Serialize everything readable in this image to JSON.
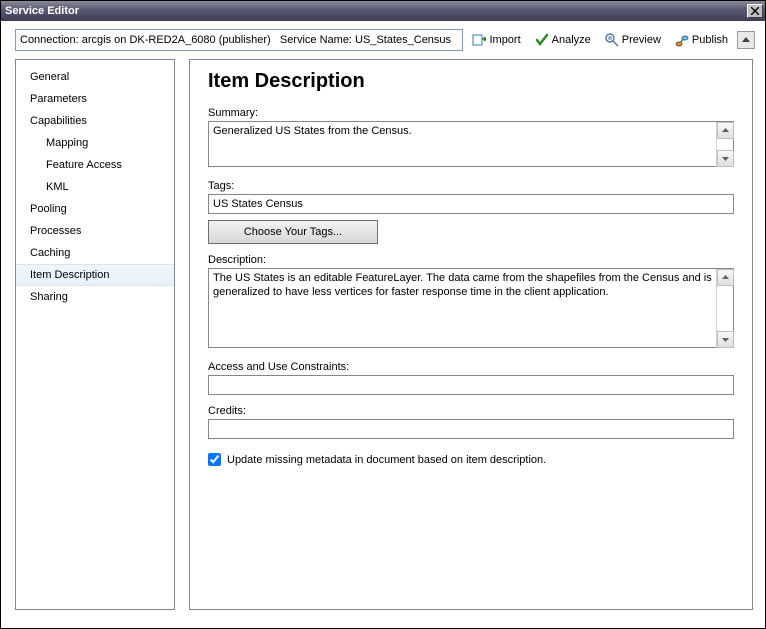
{
  "window": {
    "title": "Service Editor",
    "close": "✕"
  },
  "toolbar": {
    "connection": "Connection: arcgis on DK-RED2A_6080 (publisher)   Service Name: US_States_Census",
    "import": "Import",
    "analyze": "Analyze",
    "preview": "Preview",
    "publish": "Publish"
  },
  "sidebar": {
    "items": [
      {
        "label": "General",
        "sub": false,
        "selected": false
      },
      {
        "label": "Parameters",
        "sub": false,
        "selected": false
      },
      {
        "label": "Capabilities",
        "sub": false,
        "selected": false
      },
      {
        "label": "Mapping",
        "sub": true,
        "selected": false
      },
      {
        "label": "Feature Access",
        "sub": true,
        "selected": false
      },
      {
        "label": "KML",
        "sub": true,
        "selected": false
      },
      {
        "label": "Pooling",
        "sub": false,
        "selected": false
      },
      {
        "label": "Processes",
        "sub": false,
        "selected": false
      },
      {
        "label": "Caching",
        "sub": false,
        "selected": false
      },
      {
        "label": "Item Description",
        "sub": false,
        "selected": true
      },
      {
        "label": "Sharing",
        "sub": false,
        "selected": false
      }
    ]
  },
  "page": {
    "title": "Item Description",
    "summary_label": "Summary:",
    "summary": "Generalized US States from the Census.",
    "tags_label": "Tags:",
    "tags": "US States Census",
    "choose_tags": "Choose Your Tags...",
    "description_label": "Description:",
    "description": "The US States is an editable FeatureLayer. The data came from the shapefiles from the Census and is generalized to have less vertices for faster response time in the client application.",
    "access_label": "Access and Use Constraints:",
    "access": "",
    "credits_label": "Credits:",
    "credits": "",
    "update_meta": "Update missing metadata in document based on item description."
  }
}
